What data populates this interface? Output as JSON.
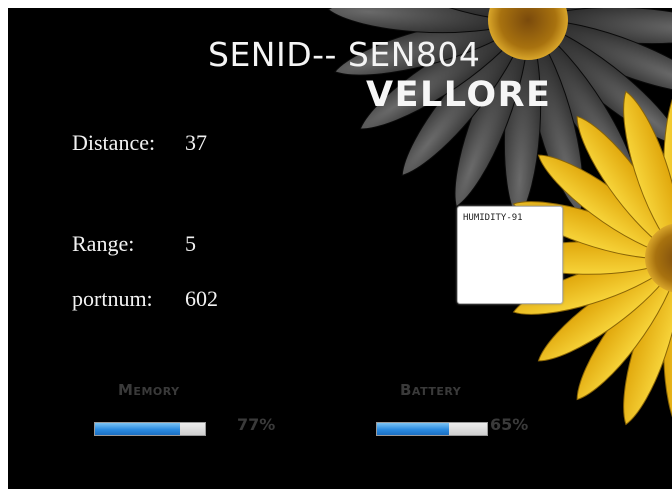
{
  "header": {
    "title": "SENID-- SEN804",
    "location": "VELLORE"
  },
  "fields": {
    "distance": {
      "label": "Distance:",
      "value": "37"
    },
    "range": {
      "label": "Range:",
      "value": "5"
    },
    "portnum": {
      "label": "portnum:",
      "value": "602"
    }
  },
  "humidity": {
    "label": "HUMIDITY-91"
  },
  "memory": {
    "label": "Memory",
    "percent_text": "77%",
    "percent": 77
  },
  "battery": {
    "label": "Battery",
    "percent_text": "65%",
    "percent": 65
  },
  "colors": {
    "background": "#000000",
    "petal": "#f2c51c",
    "bar_fill": "#2a8be0"
  }
}
